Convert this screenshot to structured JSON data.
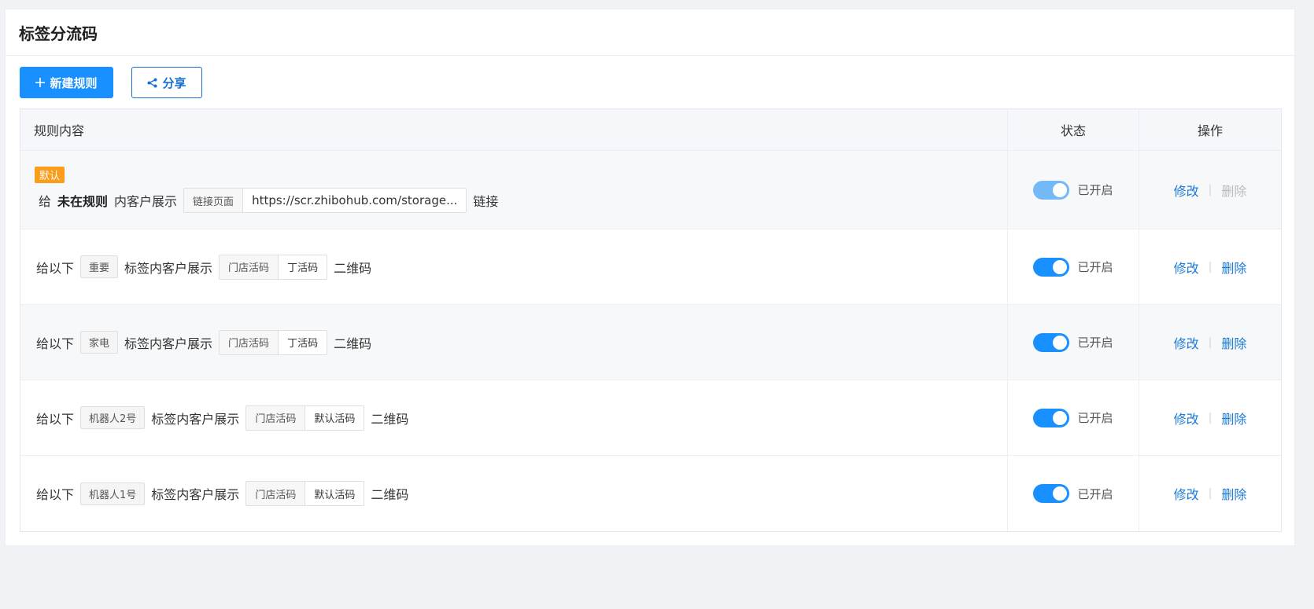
{
  "page": {
    "title": "标签分流码"
  },
  "toolbar": {
    "new_rule": "新建规则",
    "share": "分享"
  },
  "table": {
    "headers": {
      "rule": "规则内容",
      "status": "状态",
      "ops": "操作"
    },
    "rows": [
      {
        "badge": "默认",
        "prefix": "给",
        "target": "未在规则",
        "middle": "内客户展示",
        "seg_left": "链接页面",
        "seg_right": "https://scr.zhibohub.com/storage...",
        "suffix": "链接",
        "status": "已开启",
        "edit": "修改",
        "delete": "删除"
      },
      {
        "prefix": "给以下",
        "tag": "重要",
        "middle": "标签内客户展示",
        "seg_left": "门店活码",
        "seg_right": "丁活码",
        "suffix": "二维码",
        "status": "已开启",
        "edit": "修改",
        "delete": "删除"
      },
      {
        "prefix": "给以下",
        "tag": "家电",
        "middle": "标签内客户展示",
        "seg_left": "门店活码",
        "seg_right": "丁活码",
        "suffix": "二维码",
        "status": "已开启",
        "edit": "修改",
        "delete": "删除"
      },
      {
        "prefix": "给以下",
        "tag": "机器人2号",
        "middle": "标签内客户展示",
        "seg_left": "门店活码",
        "seg_right": "默认活码",
        "suffix": "二维码",
        "status": "已开启",
        "edit": "修改",
        "delete": "删除"
      },
      {
        "prefix": "给以下",
        "tag": "机器人1号",
        "middle": "标签内客户展示",
        "seg_left": "门店活码",
        "seg_right": "默认活码",
        "suffix": "二维码",
        "status": "已开启",
        "edit": "修改",
        "delete": "删除"
      }
    ]
  },
  "colors": {
    "primary": "#1890ff",
    "badge": "#fa9d1b",
    "link": "#1a7ad8"
  }
}
